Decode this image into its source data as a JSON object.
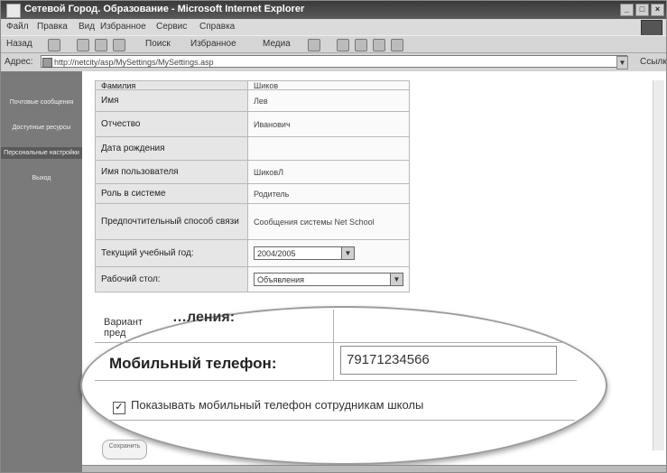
{
  "window": {
    "title": "Сетевой Город. Образование - Microsoft Internet Explorer"
  },
  "menu": [
    "Файл",
    "Правка",
    "Вид",
    "Избранное",
    "Сервис",
    "Справка"
  ],
  "toolbar": {
    "back": "Назад",
    "search": "Поиск",
    "favorites": "Избранное",
    "media": "Медиа"
  },
  "address": {
    "label": "Адрес:",
    "url": "http://netcity/asp/MySettings/MySettings.asp",
    "go": "Ссылки"
  },
  "sidebar": {
    "items": [
      {
        "label": "Почтовые сообщения"
      },
      {
        "label": "Доступные ресурсы"
      },
      {
        "label": "Персональные настройки"
      },
      {
        "label": "Выход"
      }
    ]
  },
  "form": {
    "rows": [
      {
        "label": "Фамилия",
        "value": "Шиков"
      },
      {
        "label": "Имя",
        "value": "Лев"
      },
      {
        "label": "Отчество",
        "value": "Иванович"
      },
      {
        "label": "Дата рождения",
        "value": ""
      },
      {
        "label": "Имя пользователя",
        "value": "ШиковЛ"
      },
      {
        "label": "Роль в системе",
        "value": "Родитель"
      },
      {
        "label": "Предпочтительный способ связи",
        "value": "Сообщения системы Net School"
      }
    ],
    "school_year": {
      "label": "Текущий учебный год:",
      "value": "2004/2005"
    },
    "desktop": {
      "label": "Рабочий стол:",
      "value": "Объявления"
    },
    "version_partial": "Вариант",
    "version_partial2": "пред",
    "version_zoom_partial": "…ления:"
  },
  "zoom": {
    "mobile_label": "Мобильный телефон:",
    "mobile_value": "79171234566",
    "checkbox_label": "Показывать мобильный телефон сотрудникам школы",
    "checkbox_checked": true
  },
  "save_button": {
    "label": "Сохранить"
  }
}
